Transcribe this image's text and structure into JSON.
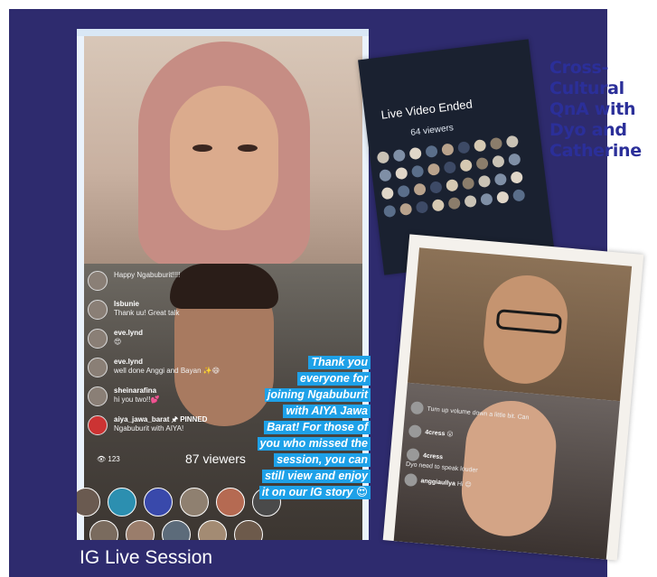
{
  "title": {
    "lines": [
      "Cross-",
      "Cultural",
      "QnA with",
      "Dyo and",
      "Catherine"
    ]
  },
  "footer": {
    "label": "IG Live Session"
  },
  "main_live": {
    "comments": [
      {
        "user": "",
        "text": "Happy Ngabuburit!!!!"
      },
      {
        "user": "Isbunie",
        "text": "Thank uu! Great talk"
      },
      {
        "user": "eve.lynd",
        "text": "😍"
      },
      {
        "user": "eve.lynd",
        "text": "well done Anggi and Bayan ✨😄"
      },
      {
        "user": "sheinarafina",
        "text": "hi you two!!💕"
      },
      {
        "user": "aiya_jawa_barat 🖈 PINNED",
        "text": "Ngabuburit with AIYA!"
      }
    ],
    "count_badge": "123",
    "viewers": "87 viewers",
    "caption_lines": [
      "Thank you",
      "everyone for",
      "joining Ngabuburit",
      "with AIYA Jawa",
      "Barat! For those of",
      "you who missed the",
      "session, you can",
      "still view and enjoy",
      "it on our IG story 😍"
    ]
  },
  "ended_card": {
    "title": "Live Video Ended",
    "viewers": "64 viewers"
  },
  "right_live": {
    "comments": [
      {
        "user": "",
        "text": "Turn up volume down a little bit. Can"
      },
      {
        "user": "4cress",
        "text": "😮"
      },
      {
        "user": "4cress",
        "text": "Dyo need to speak louder"
      },
      {
        "user": "anggiaullya",
        "text": "Hi 😊"
      }
    ]
  },
  "colors": {
    "frame": "#2e2b6e",
    "title": "#2b2f99",
    "caption_bg": "#1ea1e8"
  }
}
